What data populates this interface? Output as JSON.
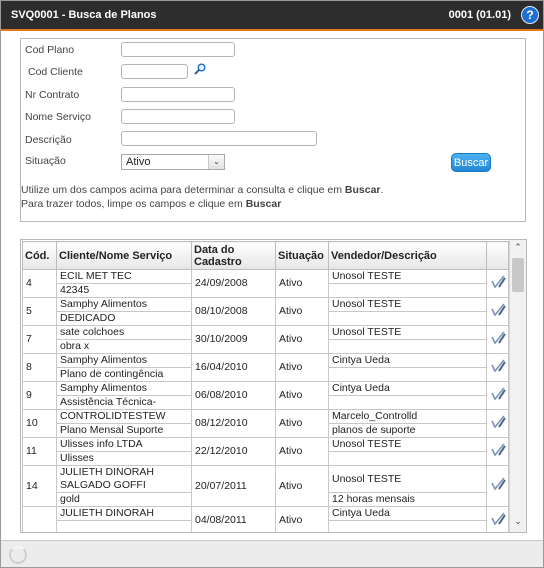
{
  "window": {
    "title": "SVQ0001 - Busca de Planos",
    "version": "0001 (01.01)",
    "help_label": "?"
  },
  "form": {
    "cod_plano": {
      "label": "Cod Plano",
      "value": "",
      "placeholder": ""
    },
    "cod_cliente": {
      "label": "Cod Cliente",
      "value": "",
      "placeholder": ""
    },
    "nr_contrato": {
      "label": "Nr Contrato",
      "value": "",
      "placeholder": ""
    },
    "nome_servico": {
      "label": "Nome Serviço",
      "value": "",
      "placeholder": ""
    },
    "descricao": {
      "label": "Descrição",
      "value": "",
      "placeholder": ""
    },
    "situacao": {
      "label": "Situação",
      "value": "Ativo"
    },
    "search_button": "Buscar",
    "help_line1_pre": "Utilize um dos campos acima para determinar a consulta e clique em ",
    "help_line1_bold": "Buscar",
    "help_line1_post": ".",
    "help_line2_pre": "Para trazer todos, limpe os campos e clique em ",
    "help_line2_bold": "Buscar"
  },
  "grid": {
    "headers": {
      "cod": "Cód.",
      "cliente": "Cliente/Nome Serviço",
      "data": "Data do Cadastro",
      "situacao": "Situação",
      "vendedor": "Vendedor/Descrição"
    },
    "rows": [
      {
        "cod": "4",
        "cliente1": "ECIL MET TEC",
        "cliente2": "",
        "data": "24/09/2008",
        "situacao": "Ativo",
        "vendedor": "Unosol TESTE",
        "servico": "42345",
        "descricao": ""
      },
      {
        "cod": "5",
        "cliente1": "Samphy Alimentos",
        "cliente2": "",
        "data": "08/10/2008",
        "situacao": "Ativo",
        "vendedor": "Unosol TESTE",
        "servico": "DEDICADO",
        "descricao": ""
      },
      {
        "cod": "7",
        "cliente1": "sate colchoes",
        "cliente2": "",
        "data": "30/10/2009",
        "situacao": "Ativo",
        "vendedor": "Unosol TESTE",
        "servico": "obra x",
        "descricao": ""
      },
      {
        "cod": "8",
        "cliente1": "Samphy Alimentos",
        "cliente2": "",
        "data": "16/04/2010",
        "situacao": "Ativo",
        "vendedor": "Cintya Ueda",
        "servico": "Plano de contingência",
        "descricao": ""
      },
      {
        "cod": "9",
        "cliente1": "Samphy Alimentos",
        "cliente2": "",
        "data": "06/08/2010",
        "situacao": "Ativo",
        "vendedor": "Cintya Ueda",
        "servico": "Assistência Técnica-",
        "descricao": ""
      },
      {
        "cod": "10",
        "cliente1": "CONTROLIDTESTEW",
        "cliente2": "",
        "data": "08/12/2010",
        "situacao": "Ativo",
        "vendedor": "Marcelo_Controlld",
        "servico": "Plano Mensal Suporte",
        "descricao": "planos de suporte"
      },
      {
        "cod": "11",
        "cliente1": "Ulisses info LTDA",
        "cliente2": "",
        "data": "22/12/2010",
        "situacao": "Ativo",
        "vendedor": "Unosol TESTE",
        "servico": "Ulisses",
        "descricao": ""
      },
      {
        "cod": "14",
        "cliente1": "JULIETH DINORAH",
        "cliente2": "SALGADO GOFFI",
        "data": "20/07/2011",
        "situacao": "Ativo",
        "vendedor": "Unosol TESTE",
        "servico": "gold",
        "descricao": "12 horas mensais"
      },
      {
        "cod": "",
        "cliente1": "JULIETH DINORAH",
        "cliente2": "",
        "data": "04/08/2011",
        "situacao": "Ativo",
        "vendedor": "Cintya Ueda",
        "servico": "",
        "descricao": ""
      }
    ]
  },
  "icons": {
    "search": "magnifier-icon",
    "select_row": "pen-check-icon",
    "help": "help-icon",
    "loading": "spinner-icon"
  }
}
